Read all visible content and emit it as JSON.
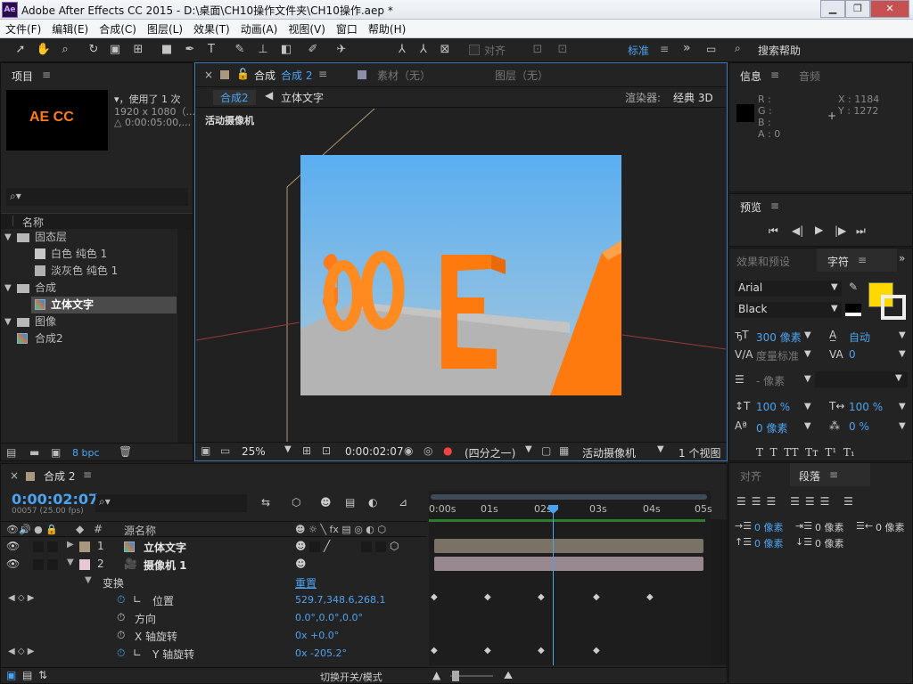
{
  "titlebar": {
    "app_icon": "Ae",
    "title": "Adobe After Effects CC 2015 - D:\\桌面\\CH10操作文件夹\\CH10操作.aep *"
  },
  "window_buttons": {
    "minimize": "▁",
    "restore": "❐",
    "close": "✕"
  },
  "menu": [
    "文件(F)",
    "编辑(E)",
    "合成(C)",
    "图层(L)",
    "效果(T)",
    "动画(A)",
    "视图(V)",
    "窗口",
    "帮助(H)"
  ],
  "toolbar": {
    "align_label": "对齐",
    "workspace": "标准",
    "search_help": "搜索帮助"
  },
  "project": {
    "tab": "项目",
    "thumb_text": "AE CC",
    "info_line1": "▾，使用了 1 次",
    "info_line2": "1920 x 1080（...",
    "info_line3": "△ 0:00:05:00,...",
    "search_icon": "⌕▾",
    "col_name": "名称",
    "items": [
      {
        "label": "固态层",
        "type": "folder",
        "expanded": "▼"
      },
      {
        "label": "白色 纯色 1",
        "type": "solid",
        "color": "#c8c8c8"
      },
      {
        "label": "淡灰色 纯色 1",
        "type": "solid",
        "color": "#b0b0b0"
      },
      {
        "label": "合成",
        "type": "folder",
        "expanded": "▼"
      },
      {
        "label": "立体文字",
        "type": "comp",
        "selected": true
      },
      {
        "label": "图像",
        "type": "folder",
        "expanded": "▼"
      },
      {
        "label": "合成2",
        "type": "comp"
      }
    ],
    "bpc": "8 bpc"
  },
  "viewer": {
    "tab_close": "×",
    "tab_label": "合成",
    "tab_comp": "合成 2",
    "tab_footage": "素材（无）",
    "tab_layer": "图层（无）",
    "crumb_active": "合成2",
    "crumb_next": "立体文字",
    "renderer_label": "渲染器:",
    "renderer_value": "经典 3D",
    "camera_label": "活动摄像机",
    "zoom": "25%",
    "timecode": "0:00:02:07",
    "resolution": "(四分之一)",
    "view_camera": "活动摄像机",
    "views": "1 个视图"
  },
  "info_panel": {
    "tab_info": "信息",
    "tab_audio": "音频",
    "r": "R :",
    "g": "G :",
    "b": "B :",
    "a": "A : 0",
    "x": "X : 1184",
    "y": "Y : 1272"
  },
  "preview_panel": {
    "tab": "预览"
  },
  "character_panel": {
    "tab_effects": "效果和预设",
    "tab_char": "字符",
    "font": "Arial",
    "style": "Black",
    "size": "300 像素",
    "leading": "自动",
    "kerning": "度量标准",
    "tracking": "0",
    "stroke_width": "- 像素",
    "v_scale": "100 %",
    "h_scale": "100 %",
    "baseline": "0 像素",
    "tsume": "0 %",
    "fill_color": "#ffd800"
  },
  "paragraph_panel": {
    "tab_align": "对齐",
    "tab_para": "段落",
    "indent_left": "0 像素",
    "indent_first": "0 像素",
    "indent_right": "0 像素",
    "space_before": "0 像素",
    "space_after": "0 像素"
  },
  "timeline": {
    "tab": "合成 2",
    "timecode": "0:00:02:07",
    "frame_info": "00057 (25.00 fps)",
    "col_hash": "#",
    "col_source": "源名称",
    "ruler": [
      "0:00s",
      "01s",
      "02s",
      "03s",
      "04s",
      "05s"
    ],
    "layers": [
      {
        "num": "1",
        "name": "立体文字",
        "color": "#a89880"
      },
      {
        "num": "2",
        "name": "摄像机 1",
        "color": "#e7c6d6"
      }
    ],
    "transform_label": "变换",
    "reset": "重置",
    "props": [
      {
        "name": "位置",
        "value": "529.7,348.6,268.1"
      },
      {
        "name": "方向",
        "value": "0.0°,0.0°,0.0°"
      },
      {
        "name": "X 轴旋转",
        "value": "0x +0.0°"
      },
      {
        "name": "Y 轴旋转",
        "value": "0x -205.2°"
      }
    ],
    "toggle_modes": "切换开关/模式"
  }
}
